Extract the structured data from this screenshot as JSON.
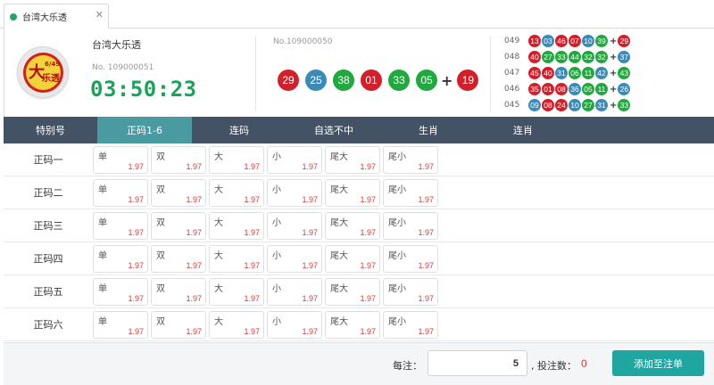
{
  "tab": {
    "label": "台湾大乐透",
    "close": "✕"
  },
  "logo": {
    "big": "大",
    "small": "乐透",
    "num": "6/49"
  },
  "lottery": {
    "name": "台湾大乐透",
    "current_issue": "No. 109000051",
    "countdown": "03:50:23"
  },
  "last_draw": {
    "issue": "No.109000050",
    "balls": [
      {
        "n": "29",
        "c": "#d21f2a"
      },
      {
        "n": "25",
        "c": "#3a8bb8"
      },
      {
        "n": "38",
        "c": "#21a83e"
      },
      {
        "n": "01",
        "c": "#d21f2a"
      },
      {
        "n": "33",
        "c": "#21a83e"
      },
      {
        "n": "05",
        "c": "#21a83e"
      }
    ],
    "plus": "+",
    "special": {
      "n": "19",
      "c": "#d21f2a"
    }
  },
  "history": [
    {
      "issue": "049",
      "balls": [
        {
          "n": "13",
          "c": "#d21f2a"
        },
        {
          "n": "03",
          "c": "#3a8bb8"
        },
        {
          "n": "46",
          "c": "#d21f2a"
        },
        {
          "n": "07",
          "c": "#d21f2a"
        },
        {
          "n": "10",
          "c": "#3a8bb8"
        },
        {
          "n": "39",
          "c": "#21a83e"
        }
      ],
      "plus": "+",
      "special": {
        "n": "29",
        "c": "#d21f2a"
      }
    },
    {
      "issue": "048",
      "balls": [
        {
          "n": "40",
          "c": "#d21f2a"
        },
        {
          "n": "27",
          "c": "#21a83e"
        },
        {
          "n": "33",
          "c": "#21a83e"
        },
        {
          "n": "44",
          "c": "#21a83e"
        },
        {
          "n": "32",
          "c": "#21a83e"
        },
        {
          "n": "32",
          "c": "#21a83e"
        }
      ],
      "plus": "+",
      "special": {
        "n": "37",
        "c": "#3a8bb8"
      }
    },
    {
      "issue": "047",
      "balls": [
        {
          "n": "45",
          "c": "#d21f2a"
        },
        {
          "n": "40",
          "c": "#d21f2a"
        },
        {
          "n": "31",
          "c": "#3a8bb8"
        },
        {
          "n": "06",
          "c": "#21a83e"
        },
        {
          "n": "11",
          "c": "#21a83e"
        },
        {
          "n": "42",
          "c": "#3a8bb8"
        }
      ],
      "plus": "+",
      "special": {
        "n": "43",
        "c": "#21a83e"
      }
    },
    {
      "issue": "046",
      "balls": [
        {
          "n": "35",
          "c": "#d21f2a"
        },
        {
          "n": "01",
          "c": "#d21f2a"
        },
        {
          "n": "08",
          "c": "#d21f2a"
        },
        {
          "n": "36",
          "c": "#3a8bb8"
        },
        {
          "n": "05",
          "c": "#21a83e"
        },
        {
          "n": "11",
          "c": "#21a83e"
        }
      ],
      "plus": "+",
      "special": {
        "n": "26",
        "c": "#3a8bb8"
      }
    },
    {
      "issue": "045",
      "balls": [
        {
          "n": "09",
          "c": "#3a8bb8"
        },
        {
          "n": "08",
          "c": "#d21f2a"
        },
        {
          "n": "24",
          "c": "#d21f2a"
        },
        {
          "n": "10",
          "c": "#3a8bb8"
        },
        {
          "n": "27",
          "c": "#21a83e"
        },
        {
          "n": "31",
          "c": "#3a8bb8"
        }
      ],
      "plus": "+",
      "special": {
        "n": "33",
        "c": "#21a83e"
      }
    }
  ],
  "nav": [
    {
      "label": "特别号",
      "w": 105,
      "active": false
    },
    {
      "label": "正码1-6",
      "w": 106,
      "active": true
    },
    {
      "label": "连码",
      "w": 106,
      "active": false
    },
    {
      "label": "自选不中",
      "w": 106,
      "active": false
    },
    {
      "label": "生肖",
      "w": 106,
      "active": false
    },
    {
      "label": "连肖",
      "w": 106,
      "active": false
    }
  ],
  "rows": [
    {
      "label": "正码一",
      "cells": [
        {
          "name": "单",
          "odds": "1.97"
        },
        {
          "name": "双",
          "odds": "1.97"
        },
        {
          "name": "大",
          "odds": "1.97"
        },
        {
          "name": "小",
          "odds": "1.97"
        },
        {
          "name": "尾大",
          "odds": "1.97"
        },
        {
          "name": "尾小",
          "odds": "1.97"
        }
      ]
    },
    {
      "label": "正码二",
      "cells": [
        {
          "name": "单",
          "odds": "1.97"
        },
        {
          "name": "双",
          "odds": "1.97"
        },
        {
          "name": "大",
          "odds": "1.97"
        },
        {
          "name": "小",
          "odds": "1.97"
        },
        {
          "name": "尾大",
          "odds": "1.97"
        },
        {
          "name": "尾小",
          "odds": "1.97"
        }
      ]
    },
    {
      "label": "正码三",
      "cells": [
        {
          "name": "单",
          "odds": "1.97"
        },
        {
          "name": "双",
          "odds": "1.97"
        },
        {
          "name": "大",
          "odds": "1.97"
        },
        {
          "name": "小",
          "odds": "1.97"
        },
        {
          "name": "尾大",
          "odds": "1.97"
        },
        {
          "name": "尾小",
          "odds": "1.97"
        }
      ]
    },
    {
      "label": "正码四",
      "cells": [
        {
          "name": "单",
          "odds": "1.97"
        },
        {
          "name": "双",
          "odds": "1.97"
        },
        {
          "name": "大",
          "odds": "1.97"
        },
        {
          "name": "小",
          "odds": "1.97"
        },
        {
          "name": "尾大",
          "odds": "1.97"
        },
        {
          "name": "尾小",
          "odds": "1.97"
        }
      ]
    },
    {
      "label": "正码五",
      "cells": [
        {
          "name": "单",
          "odds": "1.97"
        },
        {
          "name": "双",
          "odds": "1.97"
        },
        {
          "name": "大",
          "odds": "1.97"
        },
        {
          "name": "小",
          "odds": "1.97"
        },
        {
          "name": "尾大",
          "odds": "1.97"
        },
        {
          "name": "尾小",
          "odds": "1.97"
        }
      ]
    },
    {
      "label": "正码六",
      "cells": [
        {
          "name": "单",
          "odds": "1.97"
        },
        {
          "name": "双",
          "odds": "1.97"
        },
        {
          "name": "大",
          "odds": "1.97"
        },
        {
          "name": "小",
          "odds": "1.97"
        },
        {
          "name": "尾大",
          "odds": "1.97"
        },
        {
          "name": "尾小",
          "odds": "1.97"
        }
      ]
    }
  ],
  "footer": {
    "bet_label": "每注：",
    "bet_value": "5",
    "count_label": ", 投注数：",
    "count_value": "0",
    "add_button": "添加至注单"
  }
}
